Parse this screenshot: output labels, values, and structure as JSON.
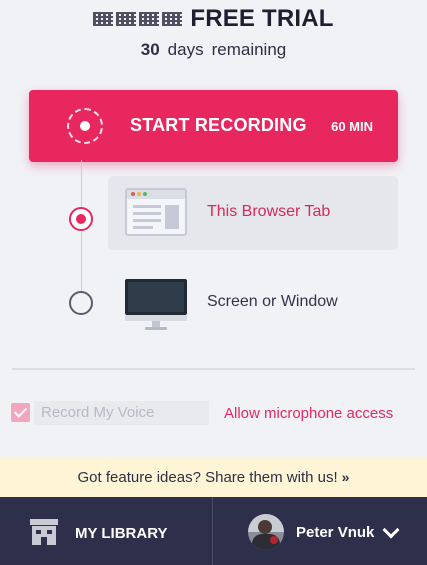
{
  "header": {
    "brand_wordmark": "HYFY",
    "title": "FREE TRIAL",
    "days_remaining": "30",
    "days_label": "days",
    "remaining_label": "remaining"
  },
  "record_button": {
    "label": "START RECORDING",
    "duration": "60 MIN"
  },
  "options": [
    {
      "label": "This Browser Tab",
      "selected": true,
      "icon": "browser-window-icon"
    },
    {
      "label": "Screen or Window",
      "selected": false,
      "icon": "monitor-icon"
    }
  ],
  "voice": {
    "label": "Record My Voice",
    "checked": true,
    "mic_link": "Allow microphone access"
  },
  "banner": {
    "text": "Got feature ideas? Share them with us!",
    "arrow": "»"
  },
  "footer": {
    "library_label": "MY LIBRARY",
    "user_name": "Peter Vnuk"
  },
  "colors": {
    "accent": "#e8275f",
    "footer_bg": "#2e2f4a",
    "banner_bg": "#fdf5d6",
    "page_bg": "#f1f2f6"
  }
}
